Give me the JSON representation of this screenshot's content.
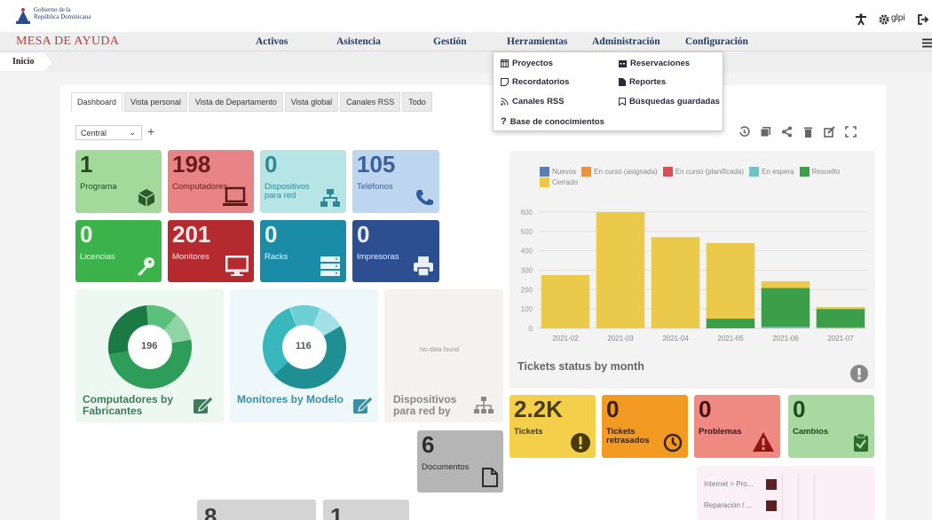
{
  "header": {
    "org_line1": "Gobierno de la",
    "org_line2": "República Dominicana",
    "brand": "MESA DE AYUDA",
    "user": "glpi"
  },
  "nav": {
    "items": [
      "Activos",
      "Asistencia",
      "Gestión",
      "Herramientas",
      "Administración",
      "Configuración"
    ]
  },
  "breadcrumb": {
    "home": "Inicio"
  },
  "tools_menu": {
    "proyectos": "Proyectos",
    "reservaciones": "Reservaciones",
    "recordatorios": "Recordatorios",
    "reportes": "Reportes",
    "canales_rss": "Canales RSS",
    "busquedas": "Búsquedas guardadas",
    "base": "Base de conocimientos"
  },
  "tabs": [
    "Dashboard",
    "Vista personal",
    "Vista de Departamento",
    "Vista global",
    "Canales RSS",
    "Todo"
  ],
  "dashboard_select": "Central",
  "tiles": [
    {
      "value": "1",
      "label": "Programa",
      "color": "#a4d99c"
    },
    {
      "value": "198",
      "label": "Computadores",
      "color": "#e98486"
    },
    {
      "value": "0",
      "label": "Dispositivos para red",
      "label1": "Dispositivos",
      "label2": "para red",
      "color": "#b7e5e6"
    },
    {
      "value": "105",
      "label": "Teléfonos",
      "color": "#bdd5ee"
    },
    {
      "value": "0",
      "label": "Licencias",
      "color": "#3bb34a"
    },
    {
      "value": "201",
      "label": "Monitores",
      "color": "#b52a2f"
    },
    {
      "value": "0",
      "label": "Racks",
      "color": "#1a8ca8"
    },
    {
      "value": "0",
      "label": "Impresoras",
      "color": "#2d4f91"
    }
  ],
  "donuts": [
    {
      "total": "196",
      "title_line1": "Computadores by",
      "title_line2": "Fabricantes"
    },
    {
      "total": "116",
      "title_line1": "Monitores by Modelo",
      "title_line2": ""
    }
  ],
  "no_data": {
    "text": "No data found",
    "title_line1": "Dispositivos",
    "title_line2": "para red by"
  },
  "documents": {
    "value": "6",
    "label": "Documentos"
  },
  "bottom_partial": [
    "8",
    "1"
  ],
  "chart_data": {
    "type": "bar",
    "title": "Tickets status by month",
    "categories": [
      "2021-02",
      "2021-03",
      "2021-04",
      "2021-05",
      "2021-06",
      "2021-07"
    ],
    "series": [
      {
        "name": "Nuevos",
        "color": "#5b7db0",
        "values": [
          0,
          0,
          0,
          0,
          0,
          0
        ]
      },
      {
        "name": "En curso (asignada)",
        "color": "#f0913a",
        "values": [
          0,
          0,
          0,
          0,
          0,
          2
        ]
      },
      {
        "name": "En curso (planificada)",
        "color": "#d65157",
        "values": [
          0,
          0,
          0,
          0,
          0,
          0
        ]
      },
      {
        "name": "En espera",
        "color": "#73c1c6",
        "values": [
          0,
          0,
          0,
          0,
          8,
          3
        ]
      },
      {
        "name": "Resuelto",
        "color": "#3c9e48",
        "values": [
          0,
          0,
          0,
          50,
          200,
          95
        ]
      },
      {
        "name": "Cerrado",
        "color": "#ebc94a",
        "values": [
          275,
          600,
          470,
          390,
          35,
          10
        ]
      }
    ],
    "yticks": [
      0,
      100,
      200,
      300,
      400,
      500,
      600
    ],
    "ylim": [
      0,
      650
    ]
  },
  "kpis": [
    {
      "value": "2.2K",
      "label": "Tickets",
      "color": "#f3cf4a"
    },
    {
      "value": "0",
      "label": "Tickets retrasados",
      "label1": "Tickets",
      "label2": "retrasados",
      "color": "#f29a22"
    },
    {
      "value": "0",
      "label": "Problemas",
      "color": "#ef8a83"
    },
    {
      "value": "0",
      "label": "Cambios",
      "color": "#a8d9a0"
    }
  ],
  "mini_rows": [
    "Internet > Pro...",
    "Reparación / ..."
  ]
}
